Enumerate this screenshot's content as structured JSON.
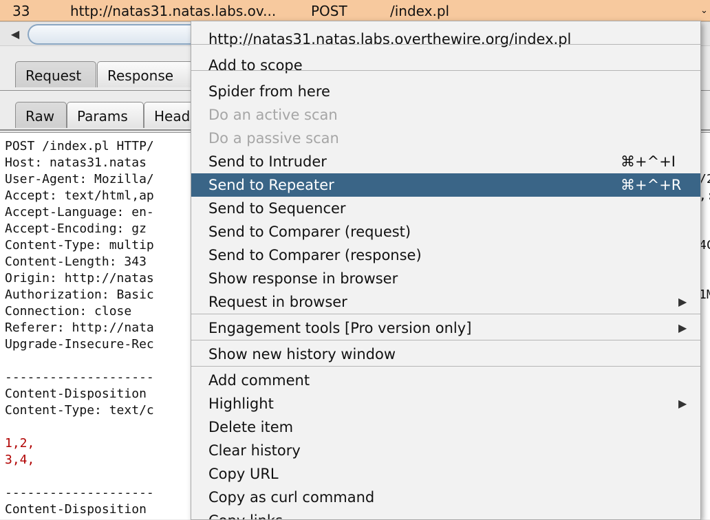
{
  "history_row": {
    "number": "33",
    "host": "http://natas31.natas.labs.ov...",
    "method": "POST",
    "path": "/index.pl",
    "chevron": "chevron-down-icon"
  },
  "tabs_main": [
    "Request",
    "Response"
  ],
  "tabs_sub": [
    "Raw",
    "Params",
    "Head"
  ],
  "raw_lines": [
    "POST /index.pl HTTP/",
    "Host: natas31.natas",
    "User-Agent: Mozilla/",
    "Accept: text/html,ap",
    "Accept-Language: en-",
    "Accept-Encoding: gz",
    "Content-Type: multip",
    "Content-Length: 343",
    "Origin: http://natas",
    "Authorization: Basic",
    "Connection: close",
    "Referer: http://nata",
    "Upgrade-Insecure-Rec",
    "",
    "--------------------",
    "Content-Disposition",
    "Content-Type: text/c",
    "",
    "1,2,",
    "3,4,",
    "",
    "--------------------",
    "Content-Disposition"
  ],
  "raw_right": [
    "",
    "",
    "/2",
    ",:",
    "",
    "",
    "4C",
    "",
    "",
    "1M",
    "",
    "",
    ""
  ],
  "menu": {
    "items": [
      {
        "label": "http://natas31.natas.labs.overthewire.org/index.pl",
        "shortcut": "",
        "submenu": false,
        "disabled": false,
        "selected": false
      },
      {
        "label": "Add to scope",
        "shortcut": "",
        "submenu": false,
        "disabled": false,
        "selected": false
      },
      {
        "label": "Spider from here",
        "shortcut": "",
        "submenu": false,
        "disabled": false,
        "selected": false
      },
      {
        "label": "Do an active scan",
        "shortcut": "",
        "submenu": false,
        "disabled": true,
        "selected": false
      },
      {
        "label": "Do a passive scan",
        "shortcut": "",
        "submenu": false,
        "disabled": true,
        "selected": false
      },
      {
        "label": "Send to Intruder",
        "shortcut": "⌘+^+I",
        "submenu": false,
        "disabled": false,
        "selected": false
      },
      {
        "label": "Send to Repeater",
        "shortcut": "⌘+^+R",
        "submenu": false,
        "disabled": false,
        "selected": true
      },
      {
        "label": "Send to Sequencer",
        "shortcut": "",
        "submenu": false,
        "disabled": false,
        "selected": false
      },
      {
        "label": "Send to Comparer (request)",
        "shortcut": "",
        "submenu": false,
        "disabled": false,
        "selected": false
      },
      {
        "label": "Send to Comparer (response)",
        "shortcut": "",
        "submenu": false,
        "disabled": false,
        "selected": false
      },
      {
        "label": "Show response in browser",
        "shortcut": "",
        "submenu": false,
        "disabled": false,
        "selected": false
      },
      {
        "label": "Request in browser",
        "shortcut": "",
        "submenu": true,
        "disabled": false,
        "selected": false
      },
      {
        "label": "Engagement tools [Pro version only]",
        "shortcut": "",
        "submenu": true,
        "disabled": false,
        "selected": false
      },
      {
        "label": "Show new history window",
        "shortcut": "",
        "submenu": false,
        "disabled": false,
        "selected": false
      },
      {
        "label": "Add comment",
        "shortcut": "",
        "submenu": false,
        "disabled": false,
        "selected": false
      },
      {
        "label": "Highlight",
        "shortcut": "",
        "submenu": true,
        "disabled": false,
        "selected": false
      },
      {
        "label": "Delete item",
        "shortcut": "",
        "submenu": false,
        "disabled": false,
        "selected": false
      },
      {
        "label": "Clear history",
        "shortcut": "",
        "submenu": false,
        "disabled": false,
        "selected": false
      },
      {
        "label": "Copy URL",
        "shortcut": "",
        "submenu": false,
        "disabled": false,
        "selected": false
      },
      {
        "label": "Copy as curl command",
        "shortcut": "",
        "submenu": false,
        "disabled": false,
        "selected": false
      },
      {
        "label": "Copy links",
        "shortcut": "",
        "submenu": false,
        "disabled": false,
        "selected": false
      }
    ]
  },
  "colors": {
    "history_row_bg": "#f7c99e",
    "menu_selected_bg": "#3a6587",
    "raw_red_text": "#b00000"
  }
}
